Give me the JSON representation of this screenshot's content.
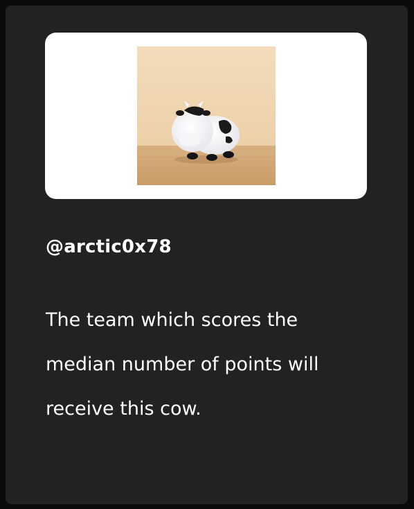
{
  "post": {
    "username": "@arctic0x78",
    "message": "The team which scores the median number of points will receive this cow."
  },
  "image": {
    "subject": "plush-cow-toy",
    "alt": ""
  },
  "colors": {
    "background": "#0b0b0b",
    "card": "#222222",
    "image_panel": "#ffffff",
    "text": "#ffffff"
  }
}
